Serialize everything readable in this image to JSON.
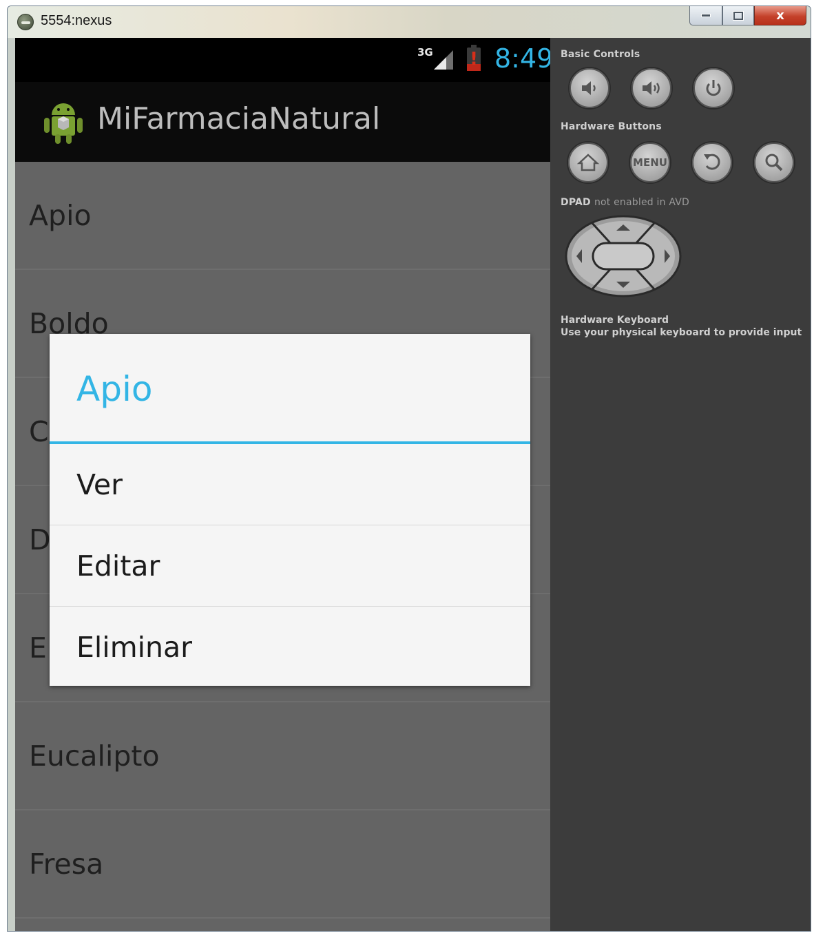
{
  "window": {
    "title": "5554:nexus",
    "minimize_label": "",
    "close_label": "x"
  },
  "statusbar": {
    "network": "3G",
    "time": "8:49"
  },
  "app": {
    "title": "MiFarmaciaNatural"
  },
  "list": {
    "items": [
      "Apio",
      "Boldo",
      "C",
      "D",
      "E",
      "Eucalipto",
      "Fresa"
    ]
  },
  "dialog": {
    "title": "Apio",
    "options": [
      "Ver",
      "Editar",
      "Eliminar"
    ]
  },
  "panel": {
    "basic_controls_label": "Basic Controls",
    "hardware_buttons_label": "Hardware Buttons",
    "menu_button_label": "MENU",
    "dpad_label": "DPAD",
    "dpad_note": "not enabled in AVD",
    "keyboard_title": "Hardware Keyboard",
    "keyboard_desc": "Use your physical keyboard to provide input"
  },
  "colors": {
    "accent": "#33b5e5",
    "list_bg": "#646464",
    "panel_bg": "#3c3c3c"
  }
}
